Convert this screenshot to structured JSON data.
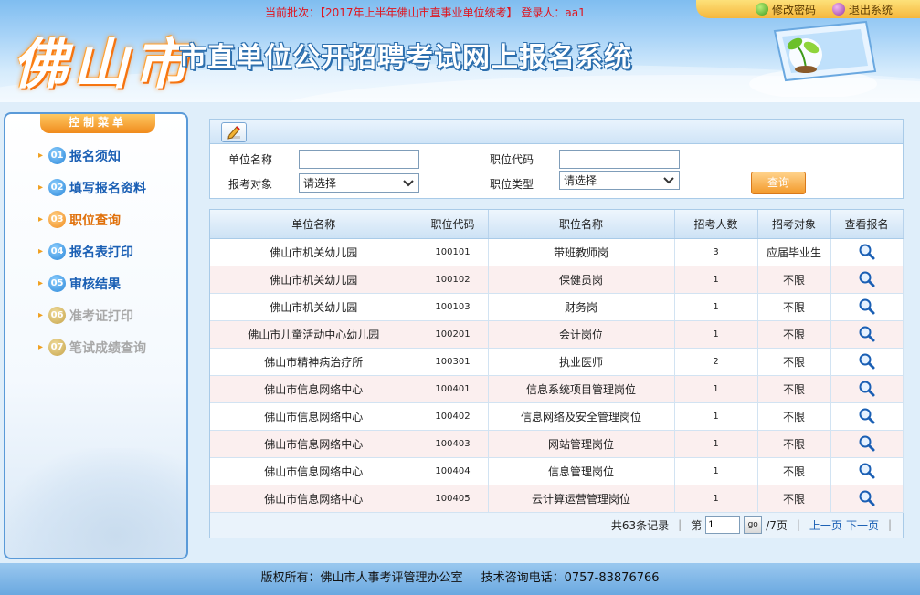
{
  "header": {
    "batch_label": "当前批次：",
    "batch_value": "【2017年上半年佛山市直事业单位统考】",
    "login_label": "登录人：",
    "login_user": "aa1",
    "city_name": "佛山市",
    "system_title": "市直单位公开招聘考试网上报名系统",
    "links": {
      "change_password": "修改密码",
      "logout": "退出系统"
    }
  },
  "sidebar": {
    "title": "控制菜单",
    "items": [
      {
        "num": "01",
        "label": "报名须知",
        "state": "normal"
      },
      {
        "num": "02",
        "label": "填写报名资料",
        "state": "normal"
      },
      {
        "num": "03",
        "label": "职位查询",
        "state": "active"
      },
      {
        "num": "04",
        "label": "报名表打印",
        "state": "normal"
      },
      {
        "num": "05",
        "label": "审核结果",
        "state": "normal"
      },
      {
        "num": "06",
        "label": "准考证打印",
        "state": "disabled"
      },
      {
        "num": "07",
        "label": "笔试成绩查询",
        "state": "disabled"
      }
    ]
  },
  "search": {
    "unit_name_label": "单位名称",
    "unit_name_value": "",
    "position_code_label": "职位代码",
    "position_code_value": "",
    "target_label": "报考对象",
    "target_selected": "请选择",
    "position_type_label": "职位类型",
    "position_type_selected": "请选择",
    "query_button": "查询"
  },
  "table": {
    "columns": [
      "单位名称",
      "职位代码",
      "职位名称",
      "招考人数",
      "招考对象",
      "查看报名"
    ],
    "rows": [
      {
        "unit": "佛山市机关幼儿园",
        "code": "100101",
        "position": "带班教师岗",
        "count": "3",
        "target": "应届毕业生"
      },
      {
        "unit": "佛山市机关幼儿园",
        "code": "100102",
        "position": "保健员岗",
        "count": "1",
        "target": "不限"
      },
      {
        "unit": "佛山市机关幼儿园",
        "code": "100103",
        "position": "财务岗",
        "count": "1",
        "target": "不限"
      },
      {
        "unit": "佛山市儿童活动中心幼儿园",
        "code": "100201",
        "position": "会计岗位",
        "count": "1",
        "target": "不限"
      },
      {
        "unit": "佛山市精神病治疗所",
        "code": "100301",
        "position": "执业医师",
        "count": "2",
        "target": "不限"
      },
      {
        "unit": "佛山市信息网络中心",
        "code": "100401",
        "position": "信息系统项目管理岗位",
        "count": "1",
        "target": "不限"
      },
      {
        "unit": "佛山市信息网络中心",
        "code": "100402",
        "position": "信息网络及安全管理岗位",
        "count": "1",
        "target": "不限"
      },
      {
        "unit": "佛山市信息网络中心",
        "code": "100403",
        "position": "网站管理岗位",
        "count": "1",
        "target": "不限"
      },
      {
        "unit": "佛山市信息网络中心",
        "code": "100404",
        "position": "信息管理岗位",
        "count": "1",
        "target": "不限"
      },
      {
        "unit": "佛山市信息网络中心",
        "code": "100405",
        "position": "云计算运营管理岗位",
        "count": "1",
        "target": "不限"
      }
    ]
  },
  "pager": {
    "total_text": "共63条记录",
    "page_prefix": "第",
    "current_page": "1",
    "go_label": "go",
    "page_suffix": "/7页",
    "prev": "上一页",
    "next": "下一页"
  },
  "footer": {
    "copyright": "版权所有：佛山市人事考评管理办公室",
    "support": "技术咨询电话：0757-83876766"
  },
  "colors": {
    "accent_blue": "#1a5fb4",
    "active_orange": "#e0700a",
    "batch_red": "#e0141e",
    "row_alt": "#fbefef"
  },
  "icons": {
    "edit": "pencil-edit-icon",
    "view": "magnifier-icon",
    "change_password": "leaf-icon",
    "logout": "purple-orb-icon"
  }
}
